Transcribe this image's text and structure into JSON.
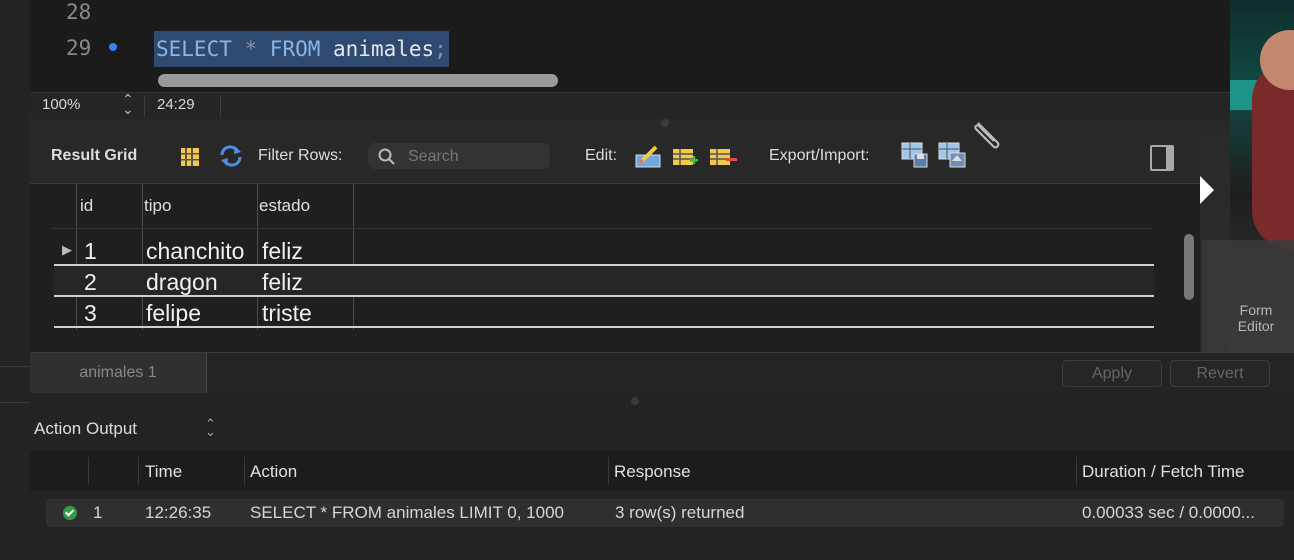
{
  "editor": {
    "line_numbers": [
      "28",
      "29"
    ],
    "query": {
      "kw_select": "SELECT",
      "star": " * ",
      "kw_from": "FROM",
      "table": " animales",
      "semicolon": ";"
    }
  },
  "status_bar": {
    "zoom": "100%",
    "cursor_position": "24:29"
  },
  "result_toolbar": {
    "title": "Result Grid",
    "filter_label": "Filter Rows:",
    "search_placeholder": "Search",
    "edit_label": "Edit:",
    "export_label": "Export/Import:"
  },
  "result_grid": {
    "columns": [
      "id",
      "tipo",
      "estado"
    ],
    "rows": [
      [
        "1",
        "chanchito",
        "feliz"
      ],
      [
        "2",
        "dragon",
        "feliz"
      ],
      [
        "3",
        "felipe",
        "triste"
      ]
    ]
  },
  "form_editor": {
    "label_line1": "Form",
    "label_line2": "Editor"
  },
  "tabs": {
    "result_tab": "animales 1",
    "apply_button": "Apply",
    "revert_button": "Revert"
  },
  "action_output": {
    "title": "Action Output",
    "columns": [
      "Time",
      "Action",
      "Response",
      "Duration / Fetch Time"
    ],
    "rows": [
      {
        "status": "success",
        "index": "1",
        "time": "12:26:35",
        "action": "SELECT * FROM animales LIMIT 0, 1000",
        "response": "3 row(s) returned",
        "duration": "0.00033 sec / 0.0000..."
      }
    ]
  },
  "colors": {
    "selection": "#2e4a70",
    "keyword": "#8cb4e6",
    "breakpoint_dot": "#3b82f6",
    "success": "#2f9e44"
  },
  "icons": [
    "breakpoint-dot-icon",
    "column-toggle-icon",
    "refresh-icon",
    "search-icon",
    "edit-row-icon",
    "add-row-icon",
    "delete-row-icon",
    "export-icon",
    "import-icon",
    "attachment-icon",
    "toggle-panel-icon",
    "success-check-icon"
  ]
}
